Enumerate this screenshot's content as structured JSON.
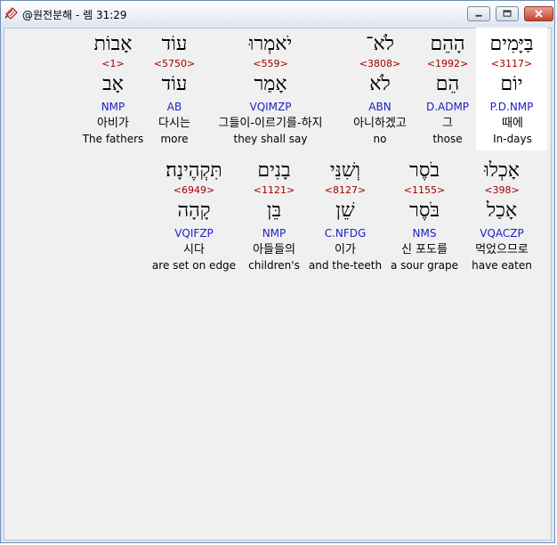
{
  "window": {
    "title": "@원전분해 - 렘 31:29"
  },
  "controls": {
    "minimize": "minimize",
    "maximize": "maximize",
    "close": "close"
  },
  "rows": [
    {
      "words": [
        {
          "hebrew": "בַּיָּמִים",
          "strong": "<3117>",
          "lemma": "יוֹם",
          "morph": "P.D.NMP",
          "korean": "때에",
          "english": "In-days",
          "selected": true
        },
        {
          "hebrew": "הָהֵם",
          "strong": "<1992>",
          "lemma": "הֵם",
          "morph": "D.ADMP",
          "korean": "그",
          "english": "those"
        },
        {
          "hebrew": "לֹא־",
          "strong": "<3808>",
          "lemma": "לֹא",
          "morph": "ABN",
          "korean": "아니하겠고",
          "english": "no"
        },
        {
          "hebrew": "יֹאמְרוּ",
          "strong": "<559>",
          "lemma": "אָמַר",
          "morph": "VQIMZP",
          "korean": "그들이-이르기를-하지",
          "english": "they shall say"
        },
        {
          "hebrew": "עוֹד",
          "strong": "<5750>",
          "lemma": "עוֹד",
          "morph": "AB",
          "korean": "다시는",
          "english": "more"
        },
        {
          "hebrew": "אָבוֹת",
          "strong": "<1>",
          "lemma": "אָב",
          "morph": "NMP",
          "korean": "아비가",
          "english": "The fathers"
        }
      ]
    },
    {
      "words": [
        {
          "hebrew": "אָכְלוּ",
          "strong": "<398>",
          "lemma": "אָכַל",
          "morph": "VQACZP",
          "korean": "먹었으므로",
          "english": "have eaten"
        },
        {
          "hebrew": "בֹסֶר",
          "strong": "<1155>",
          "lemma": "בֹּסֶר",
          "morph": "NMS",
          "korean": "신 포도를",
          "english": "a sour grape"
        },
        {
          "hebrew": "וְשִׁנֵּי",
          "strong": "<8127>",
          "lemma": "שֵׁן",
          "morph": "C.NFDG",
          "korean": "이가",
          "english": "and the-teeth"
        },
        {
          "hebrew": "בָנִים",
          "strong": "<1121>",
          "lemma": "בֵּן",
          "morph": "NMP",
          "korean": "아들들의",
          "english": "children's"
        },
        {
          "hebrew": "תִּקְהֶינָה׃",
          "strong": "<6949>",
          "lemma": "קָהָה",
          "morph": "VQIFZP",
          "korean": "시다",
          "english": "are set on edge"
        }
      ]
    }
  ]
}
